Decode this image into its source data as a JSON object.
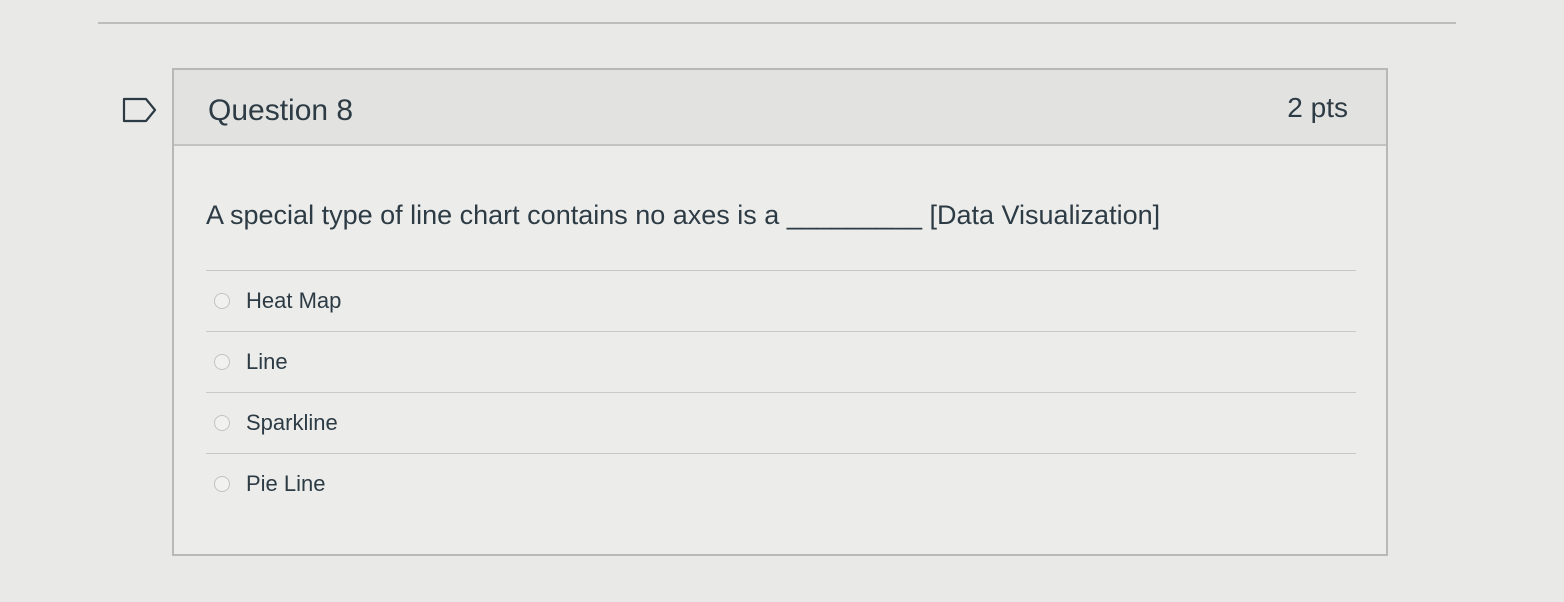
{
  "question": {
    "title": "Question 8",
    "points": "2 pts",
    "text": "A special type of line chart contains no axes is a _________ [Data Visualization]",
    "flag_icon": "flag-outline-icon"
  },
  "answers": [
    {
      "label": "Heat Map",
      "selected": false
    },
    {
      "label": "Line",
      "selected": false
    },
    {
      "label": "Sparkline",
      "selected": false
    },
    {
      "label": "Pie Line",
      "selected": false
    }
  ]
}
